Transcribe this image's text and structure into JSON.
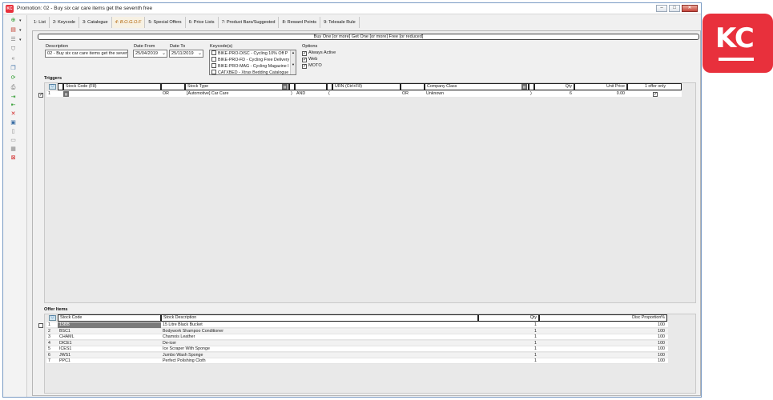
{
  "window": {
    "title": "Promotion: 02 - Buy six car care items get the seventh free",
    "app_icon_text": "KC",
    "min": "–",
    "max": "□",
    "close": "✕"
  },
  "toolbar": {
    "icons": [
      "add-icon",
      "layers-icon",
      "list-icon",
      "filter-icon",
      "back-icon",
      "copy-icon",
      "refresh-icon",
      "print-icon",
      "export-icon",
      "import-icon",
      "delete-icon",
      "save-icon",
      "page-icon",
      "document-icon",
      "form-icon",
      "exit-icon"
    ]
  },
  "tabs": [
    {
      "label": "1: List"
    },
    {
      "label": "2: Keycode"
    },
    {
      "label": "3: Catalogue"
    },
    {
      "label": "4: B.O.G.O.F",
      "active": true
    },
    {
      "label": "5: Special Offers"
    },
    {
      "label": "6: Price Lists"
    },
    {
      "label": "7: Product Bars/Suggested"
    },
    {
      "label": "8: Reward Points"
    },
    {
      "label": "9: Telesale Rule"
    }
  ],
  "banner": "Buy One [or more] Get One [or more] Free [or reduced]",
  "form": {
    "description_label": "Description",
    "description_value": "02 - Buy six car care items get the seven",
    "date_from_label": "Date From",
    "date_from_value": "25/04/2019",
    "date_to_label": "Date To",
    "date_to_value": "25/11/2019",
    "keycodes_label": "Keycode(s)",
    "keycodes": [
      {
        "label": "BIKE-PRO-DISC - Cycling 10% Off P"
      },
      {
        "label": "BIKE-PRO-FD - Cycling Free Delivery"
      },
      {
        "label": "BIKE-PRO-MAG - Cycling Magazine I"
      },
      {
        "label": "CATXBED - Xtras Bedding Catalogue"
      }
    ],
    "options_label": "Options",
    "options": [
      {
        "label": "Always Active",
        "checked": true
      },
      {
        "label": "Web",
        "checked": true
      },
      {
        "label": "MOTO",
        "checked": true
      }
    ]
  },
  "triggers": {
    "title": "Triggers",
    "headers": {
      "stock_code": "Stock Code (F8)",
      "stock_type": "Stock Type",
      "urn": "URN (Ctrl+F8)",
      "company_class": "Company Class",
      "qty": "Qty",
      "unit_price": "Unit Price",
      "one_offer": "1 offer only"
    },
    "row": {
      "num": "1",
      "or1": "OR",
      "stock_type": "[Automotive] Car Care",
      "paren_close1": ")",
      "and": "AND",
      "paren_open": "(",
      "or2": "OR",
      "company_class": "Unknown",
      "paren_close2": ")",
      "qty": "6",
      "unit_price": "0.00"
    }
  },
  "offer_items": {
    "title": "Offer Items",
    "headers": {
      "stock_code": "Stock Code",
      "stock_description": "Stock Description",
      "qty": "Qty",
      "disc": "Disc Proportion%"
    },
    "rows": [
      {
        "num": "1",
        "code": "15BB",
        "description": "15 Litre Black Bucket",
        "qty": "1",
        "disc": "100"
      },
      {
        "num": "2",
        "code": "BSC1",
        "description": "Bodywork Shampoo Conditioner",
        "qty": "1",
        "disc": "100"
      },
      {
        "num": "3",
        "code": "CHAML",
        "description": "Chamois Leather",
        "qty": "1",
        "disc": "100"
      },
      {
        "num": "4",
        "code": "DICE1",
        "description": "De-icer",
        "qty": "1",
        "disc": "100"
      },
      {
        "num": "5",
        "code": "ICES1",
        "description": "Ice Scraper With Sponge",
        "qty": "1",
        "disc": "100"
      },
      {
        "num": "6",
        "code": "JWS1",
        "description": "Jumbo Wash Sponge",
        "qty": "1",
        "disc": "100"
      },
      {
        "num": "7",
        "code": "PPC1",
        "description": "Perfect Polishing Cloth",
        "qty": "1",
        "disc": "100"
      }
    ]
  },
  "logo": {
    "text": "KC",
    "color": "#e8303c"
  }
}
